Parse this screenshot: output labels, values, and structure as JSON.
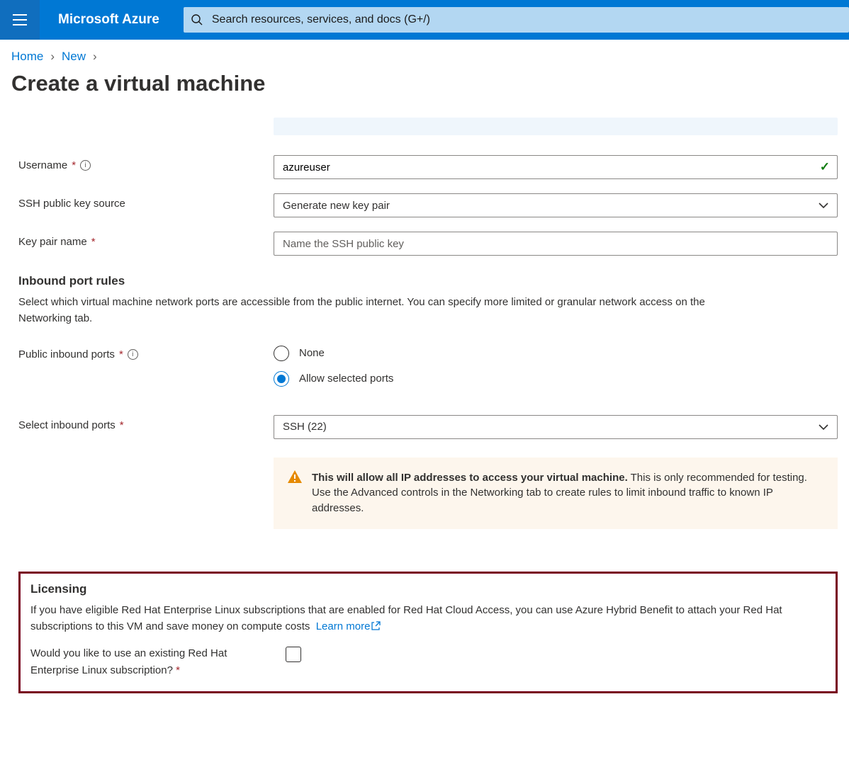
{
  "topbar": {
    "brand": "Microsoft Azure",
    "search_placeholder": "Search resources, services, and docs (G+/)"
  },
  "breadcrumb": {
    "home": "Home",
    "new": "New"
  },
  "page_title": "Create a virtual machine",
  "form": {
    "username_label": "Username",
    "username_value": "azureuser",
    "ssh_source_label": "SSH public key source",
    "ssh_source_value": "Generate new key pair",
    "keypair_label": "Key pair name",
    "keypair_placeholder": "Name the SSH public key"
  },
  "inbound": {
    "title": "Inbound port rules",
    "desc": "Select which virtual machine network ports are accessible from the public internet. You can specify more limited or granular network access on the Networking tab.",
    "public_ports_label": "Public inbound ports",
    "option_none": "None",
    "option_allow": "Allow selected ports",
    "select_ports_label": "Select inbound ports",
    "select_ports_value": "SSH (22)",
    "warning_bold": "This will allow all IP addresses to access your virtual machine.",
    "warning_rest": "  This is only recommended for testing.  Use the Advanced controls in the Networking tab to create rules to limit inbound traffic to known IP addresses."
  },
  "licensing": {
    "title": "Licensing",
    "desc": "If you have eligible Red Hat Enterprise Linux subscriptions that are enabled for Red Hat Cloud Access, you can use Azure Hybrid Benefit to attach your Red Hat subscriptions to this VM and save money on compute costs",
    "learn_more": "Learn more",
    "question": "Would you like to use an existing Red Hat Enterprise Linux subscription?"
  }
}
